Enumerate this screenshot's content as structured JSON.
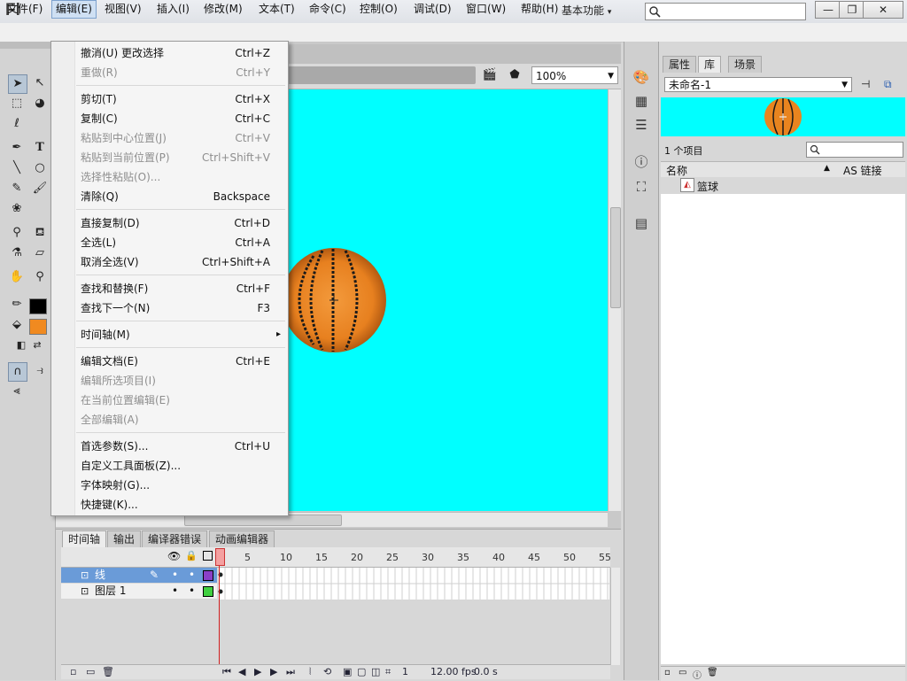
{
  "app": {
    "logo": "Fl",
    "workspace": "基本功能",
    "window_buttons": {
      "minimize": "—",
      "restore": "❐",
      "close": "✕"
    }
  },
  "menubar": [
    {
      "label": "文件(F)"
    },
    {
      "label": "编辑(E)",
      "active": true
    },
    {
      "label": "视图(V)"
    },
    {
      "label": "插入(I)"
    },
    {
      "label": "修改(M)"
    },
    {
      "label": "文本(T)"
    },
    {
      "label": "命令(C)"
    },
    {
      "label": "控制(O)"
    },
    {
      "label": "调试(D)"
    },
    {
      "label": "窗口(W)"
    },
    {
      "label": "帮助(H)"
    }
  ],
  "edit_menu": {
    "items": [
      {
        "label": "撤消(U) 更改选择",
        "shortcut": "Ctrl+Z",
        "enabled": true
      },
      {
        "label": "重做(R)",
        "shortcut": "Ctrl+Y",
        "enabled": false
      },
      {
        "label": "剪切(T)",
        "shortcut": "Ctrl+X",
        "enabled": true
      },
      {
        "label": "复制(C)",
        "shortcut": "Ctrl+C",
        "enabled": true
      },
      {
        "label": "粘贴到中心位置(J)",
        "shortcut": "Ctrl+V",
        "enabled": false
      },
      {
        "label": "粘贴到当前位置(P)",
        "shortcut": "Ctrl+Shift+V",
        "enabled": false
      },
      {
        "label": "选择性粘贴(O)...",
        "shortcut": "",
        "enabled": false
      },
      {
        "label": "清除(Q)",
        "shortcut": "Backspace",
        "enabled": true
      },
      {
        "label": "直接复制(D)",
        "shortcut": "Ctrl+D",
        "enabled": true
      },
      {
        "label": "全选(L)",
        "shortcut": "Ctrl+A",
        "enabled": true
      },
      {
        "label": "取消全选(V)",
        "shortcut": "Ctrl+Shift+A",
        "enabled": true
      },
      {
        "label": "查找和替换(F)",
        "shortcut": "Ctrl+F",
        "enabled": true
      },
      {
        "label": "查找下一个(N)",
        "shortcut": "F3",
        "enabled": true
      },
      {
        "label": "时间轴(M)",
        "shortcut": "▸",
        "enabled": true
      },
      {
        "label": "编辑文档(E)",
        "shortcut": "Ctrl+E",
        "enabled": true
      },
      {
        "label": "编辑所选项目(I)",
        "shortcut": "",
        "enabled": false
      },
      {
        "label": "在当前位置编辑(E)",
        "shortcut": "",
        "enabled": false
      },
      {
        "label": "全部编辑(A)",
        "shortcut": "",
        "enabled": false
      },
      {
        "label": "首选参数(S)...",
        "shortcut": "Ctrl+U",
        "enabled": true
      },
      {
        "label": "自定义工具面板(Z)...",
        "shortcut": "",
        "enabled": true
      },
      {
        "label": "字体映射(G)...",
        "shortcut": "",
        "enabled": true
      },
      {
        "label": "快捷键(K)...",
        "shortcut": "",
        "enabled": true
      }
    ]
  },
  "stage": {
    "zoom": "100%",
    "background": "#00ffff"
  },
  "timeline": {
    "tabs": [
      "时间轴",
      "输出",
      "编译器错误",
      "动画编辑器"
    ],
    "active_tab": "时间轴",
    "frame_numbers": [
      "1",
      "5",
      "10",
      "15",
      "20",
      "25",
      "30",
      "35",
      "40",
      "45",
      "50",
      "55"
    ],
    "layers": [
      {
        "name": "线",
        "selected": true,
        "color": "#8b3fc7"
      },
      {
        "name": "图层 1",
        "selected": false,
        "color": "#40d040"
      }
    ],
    "status": {
      "frame": "1",
      "fps": "12.00",
      "fps_unit": "fps",
      "time": "0.0 s"
    }
  },
  "right_panel": {
    "tabs": [
      "属性",
      "库",
      "场景"
    ],
    "active_tab": "库",
    "library_doc": "未命名-1",
    "item_count": "1 个项目",
    "columns": {
      "name": "名称",
      "linkage": "AS 链接"
    },
    "items": [
      {
        "name": "篮球",
        "icon": "graphic-symbol-icon"
      }
    ]
  }
}
